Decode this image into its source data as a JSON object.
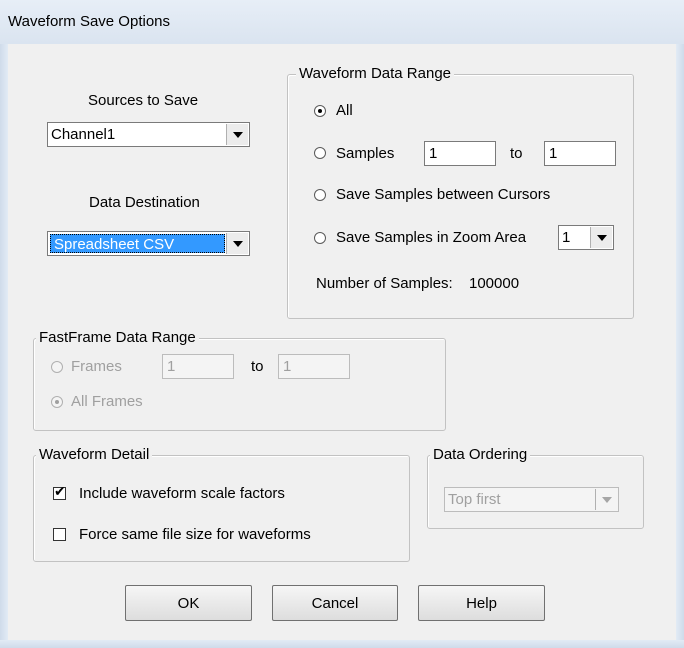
{
  "window": {
    "title": "Waveform Save Options"
  },
  "sources": {
    "label": "Sources to Save",
    "value": "Channel1"
  },
  "destination": {
    "label": "Data Destination",
    "value": "Spreadsheet CSV"
  },
  "waveform_range": {
    "title": "Waveform Data Range",
    "all_label": "All",
    "samples_label": "Samples",
    "samples_from": "1",
    "to_label": "to",
    "samples_to": "1",
    "cursors_label": "Save Samples between Cursors",
    "zoom_label": "Save Samples in Zoom Area",
    "zoom_value": "1",
    "num_samples_label": "Number of Samples:",
    "num_samples_value": "100000",
    "selected": "All"
  },
  "fastframe": {
    "title": "FastFrame Data Range",
    "frames_label": "Frames",
    "frames_from": "1",
    "to_label": "to",
    "frames_to": "1",
    "all_frames_label": "All Frames",
    "selected": "All Frames",
    "enabled": false
  },
  "waveform_detail": {
    "title": "Waveform Detail",
    "scale_factors_label": "Include waveform scale factors",
    "scale_factors_checked": true,
    "same_size_label": "Force same file size for waveforms",
    "same_size_checked": false
  },
  "ordering": {
    "title": "Data Ordering",
    "value": "Top first",
    "enabled": false
  },
  "buttons": {
    "ok": "OK",
    "cancel": "Cancel",
    "help": "Help"
  },
  "checkmark_glyph": "✔"
}
